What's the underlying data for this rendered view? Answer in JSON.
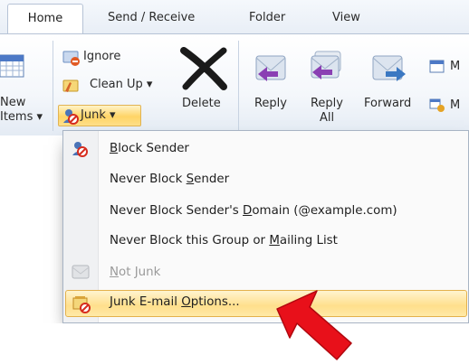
{
  "tabs": [
    "Home",
    "Send / Receive",
    "Folder",
    "View"
  ],
  "ribbon": {
    "new_items": [
      "New",
      "Items ▾"
    ],
    "ignore": "Ignore",
    "clean_up": "Clean Up ▾",
    "junk": "Junk ▾",
    "delete": "Delete",
    "reply": "Reply",
    "reply_all": [
      "Reply",
      "All"
    ],
    "forward": "Forward",
    "more1": "M",
    "more2": "M"
  },
  "menu": {
    "block_sender": {
      "key": "B",
      "rest": "lock Sender"
    },
    "never_block_sender": {
      "pre": "Never Block ",
      "key": "S",
      "rest": "ender"
    },
    "never_block_domain": {
      "pre": "Never Block Sender's ",
      "key": "D",
      "rest": "omain (@example.com)"
    },
    "never_block_group": {
      "pre": "Never Block this Group or ",
      "key": "M",
      "rest": "ailing List"
    },
    "not_junk": {
      "pre": "",
      "key": "N",
      "rest": "ot Junk"
    },
    "junk_options": {
      "pre": "Junk E-mail ",
      "key": "O",
      "rest": "ptions..."
    }
  },
  "colors": {
    "highlight": "#ffdf8c",
    "arrow": "#e8101a",
    "ribbon_border": "#b6c3d6"
  }
}
